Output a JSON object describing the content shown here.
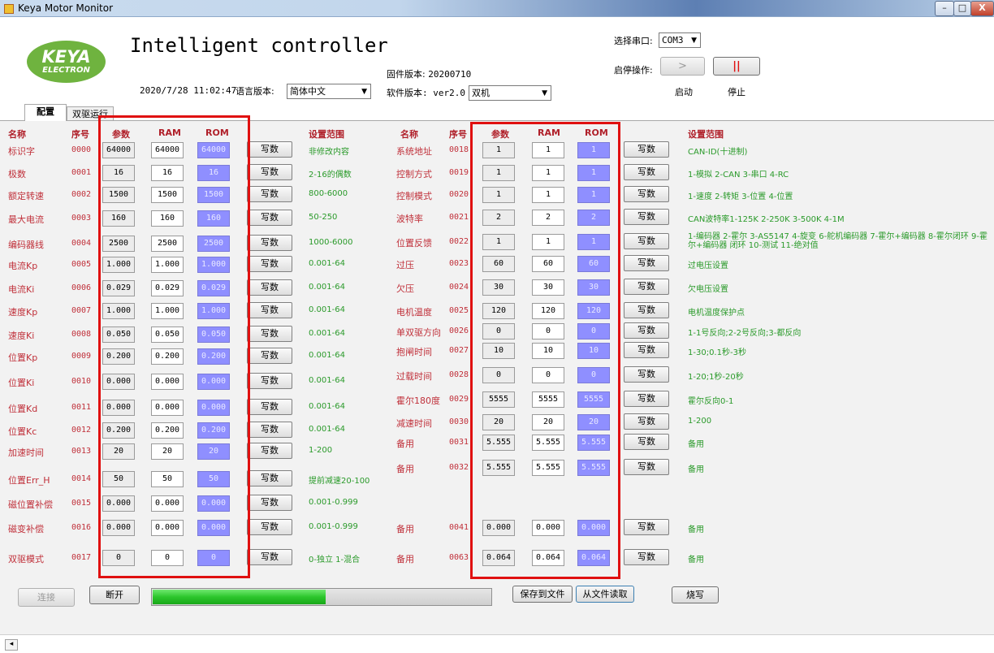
{
  "window": {
    "title": "Keya Motor Monitor",
    "minimize": "–",
    "maximize": "□",
    "close": "X"
  },
  "header": {
    "logo_main": "KEYA",
    "logo_sub": "ELECTRON",
    "title": "Intelligent controller",
    "datetime": "2020/7/28 11:02:47",
    "language_label": "语言版本:",
    "language_value": "简体中文",
    "firmware_label": "固件版本:",
    "firmware_value": "20200710",
    "software_label": "软件版本: ver2.0",
    "mode_value": "双机",
    "port_label": "选择串口:",
    "port_value": "COM3",
    "startstop_label": "启停操作:",
    "start_label": "启动",
    "stop_label": "停止",
    "start_icon": ">",
    "stop_icon": "||"
  },
  "tabs": [
    {
      "label": "配置"
    },
    {
      "label": "双驱运行"
    }
  ],
  "columns": {
    "name": "名称",
    "index": "序号",
    "param": "参数",
    "ram": "RAM",
    "rom": "ROM",
    "range": "设置范围",
    "write": "写数"
  },
  "left_rows": [
    {
      "name": "标识字",
      "index": "0000",
      "param": "64000",
      "ram": "64000",
      "rom": "64000",
      "range": "非修改内容"
    },
    {
      "name": "极数",
      "index": "0001",
      "param": "16",
      "ram": "16",
      "rom": "16",
      "range": "2-16的偶数"
    },
    {
      "name": "额定转速",
      "index": "0002",
      "param": "1500",
      "ram": "1500",
      "rom": "1500",
      "range": "800-6000"
    },
    {
      "name": "最大电流",
      "index": "0003",
      "param": "160",
      "ram": "160",
      "rom": "160",
      "range": "50-250"
    },
    {
      "name": "编码器线",
      "index": "0004",
      "param": "2500",
      "ram": "2500",
      "rom": "2500",
      "range": "1000-6000"
    },
    {
      "name": "电流Kp",
      "index": "0005",
      "param": "1.000",
      "ram": "1.000",
      "rom": "1.000",
      "range": "0.001-64"
    },
    {
      "name": "电流Ki",
      "index": "0006",
      "param": "0.029",
      "ram": "0.029",
      "rom": "0.029",
      "range": "0.001-64"
    },
    {
      "name": "速度Kp",
      "index": "0007",
      "param": "1.000",
      "ram": "1.000",
      "rom": "1.000",
      "range": "0.001-64"
    },
    {
      "name": "速度Ki",
      "index": "0008",
      "param": "0.050",
      "ram": "0.050",
      "rom": "0.050",
      "range": "0.001-64"
    },
    {
      "name": "位置Kp",
      "index": "0009",
      "param": "0.200",
      "ram": "0.200",
      "rom": "0.200",
      "range": "0.001-64"
    },
    {
      "name": "位置Ki",
      "index": "0010",
      "param": "0.000",
      "ram": "0.000",
      "rom": "0.000",
      "range": "0.001-64"
    },
    {
      "name": "位置Kd",
      "index": "0011",
      "param": "0.000",
      "ram": "0.000",
      "rom": "0.000",
      "range": "0.001-64"
    },
    {
      "name": "位置Kc",
      "index": "0012",
      "param": "0.200",
      "ram": "0.200",
      "rom": "0.200",
      "range": "0.001-64"
    },
    {
      "name": "加速时间",
      "index": "0013",
      "param": "20",
      "ram": "20",
      "rom": "20",
      "range": "1-200"
    },
    {
      "name": "位置Err_H",
      "index": "0014",
      "param": "50",
      "ram": "50",
      "rom": "50",
      "range": "提前减速20-100"
    },
    {
      "name": "磁位置补偿",
      "index": "0015",
      "param": "0.000",
      "ram": "0.000",
      "rom": "0.000",
      "range": "0.001-0.999"
    },
    {
      "name": "磁变补偿",
      "index": "0016",
      "param": "0.000",
      "ram": "0.000",
      "rom": "0.000",
      "range": "0.001-0.999"
    },
    {
      "name": "双驱模式",
      "index": "0017",
      "param": "0",
      "ram": "0",
      "rom": "0",
      "range": "0-独立 1-混合"
    }
  ],
  "right_rows": [
    {
      "name": "系统地址",
      "index": "0018",
      "param": "1",
      "ram": "1",
      "rom": "1",
      "range": "CAN-ID(十进制)"
    },
    {
      "name": "控制方式",
      "index": "0019",
      "param": "1",
      "ram": "1",
      "rom": "1",
      "range": "1-模拟 2-CAN 3-串口 4-RC"
    },
    {
      "name": "控制模式",
      "index": "0020",
      "param": "1",
      "ram": "1",
      "rom": "1",
      "range": "1-速度 2-转矩 3-位置 4-位置"
    },
    {
      "name": "波特率",
      "index": "0021",
      "param": "2",
      "ram": "2",
      "rom": "2",
      "range": "CAN波特率1-125K 2-250K 3-500K 4-1M"
    },
    {
      "name": "位置反馈",
      "index": "0022",
      "param": "1",
      "ram": "1",
      "rom": "1",
      "range": "1-编码器 2-霍尔 3-AS5147 4-旋变 6-舵机编码器 7-霍尔+编码器 8-霍尔闭环 9-霍尔+编码器 闭环 10-测试 11-绝对值"
    },
    {
      "name": "过压",
      "index": "0023",
      "param": "60",
      "ram": "60",
      "rom": "60",
      "range": "过电压设置"
    },
    {
      "name": "欠压",
      "index": "0024",
      "param": "30",
      "ram": "30",
      "rom": "30",
      "range": "欠电压设置"
    },
    {
      "name": "电机温度",
      "index": "0025",
      "param": "120",
      "ram": "120",
      "rom": "120",
      "range": "电机温度保护点"
    },
    {
      "name": "单双驱方向",
      "index": "0026",
      "param": "0",
      "ram": "0",
      "rom": "0",
      "range": "1-1号反向;2-2号反向;3-都反向"
    },
    {
      "name": "抱闸时间",
      "index": "0027",
      "param": "10",
      "ram": "10",
      "rom": "10",
      "range": "1-30;0.1秒-3秒"
    },
    {
      "name": "过载时间",
      "index": "0028",
      "param": "0",
      "ram": "0",
      "rom": "0",
      "range": "1-20;1秒-20秒"
    },
    {
      "name": "霍尔180度",
      "index": "0029",
      "param": "5555",
      "ram": "5555",
      "rom": "5555",
      "range": "霍尔反向0-1"
    },
    {
      "name": "减速时间",
      "index": "0030",
      "param": "20",
      "ram": "20",
      "rom": "20",
      "range": "1-200"
    },
    {
      "name": "备用",
      "index": "0031",
      "param": "5.555",
      "ram": "5.555",
      "rom": "5.555",
      "range": "备用"
    },
    {
      "name": "备用",
      "index": "0032",
      "param": "5.555",
      "ram": "5.555",
      "rom": "5.555",
      "range": "备用"
    },
    {
      "name": "备用",
      "index": "0041",
      "param": "0.000",
      "ram": "0.000",
      "rom": "0.000",
      "range": "备用"
    },
    {
      "name": "备用",
      "index": "0063",
      "param": "0.064",
      "ram": "0.064",
      "rom": "0.064",
      "range": "备用"
    }
  ],
  "footer": {
    "connect": "连接",
    "disconnect": "断开",
    "progress": 0.51,
    "save_file": "保存到文件",
    "load_file": "从文件读取",
    "burn": "烧写"
  }
}
